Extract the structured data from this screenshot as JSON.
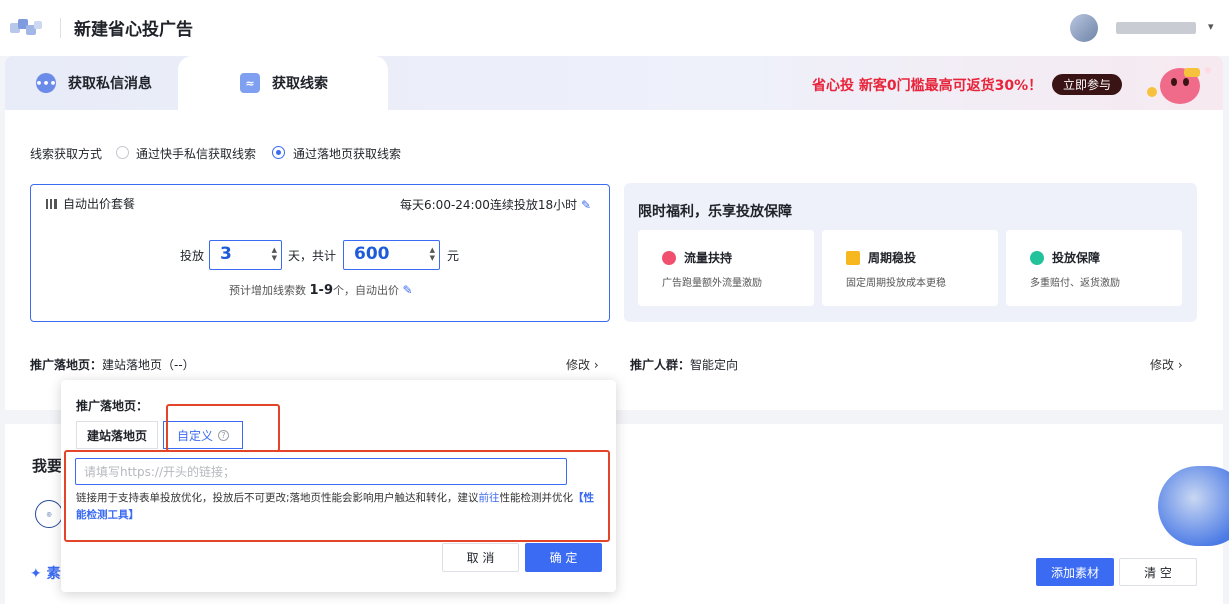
{
  "header": {
    "title": "新建省心投广告"
  },
  "tabs": [
    {
      "label": "获取私信消息"
    },
    {
      "label": "获取线索"
    }
  ],
  "promo": {
    "text": "省心投 新客0门槛最高可返货30%！",
    "button": "立即参与"
  },
  "lead_method": {
    "label": "线索获取方式",
    "options": [
      "通过快手私信获取线索",
      "通过落地页获取线索"
    ],
    "selected_index": 1
  },
  "bid_package": {
    "title": "自动出价套餐",
    "schedule": "每天6:00-24:00连续投放18小时",
    "days_label": "投放",
    "days_value": "3",
    "days_unit": "天，共计",
    "amount_value": "600",
    "amount_unit": "元",
    "estimate_prefix": "预计增加线索数",
    "estimate_range": "1-9",
    "estimate_suffix": "个，自动出价"
  },
  "benefits": {
    "title": "限时福利，乐享投放保障",
    "items": [
      {
        "name": "流量扶持",
        "desc": "广告跑量额外流量激励",
        "color": "#f0506e"
      },
      {
        "name": "周期稳投",
        "desc": "固定周期投放成本更稳",
        "color": "#f6b81e"
      },
      {
        "name": "投放保障",
        "desc": "多重赔付、返货激励",
        "color": "#21c29c"
      }
    ]
  },
  "landing_row": {
    "label": "推广落地页：",
    "value": "建站落地页（--）",
    "modify": "修改"
  },
  "audience_row": {
    "label": "推广人群：",
    "value": "智能定向",
    "modify": "修改"
  },
  "material_section": {
    "title": "我要",
    "spark_label": "素",
    "add_button": "添加素材",
    "clear_button": "清 空"
  },
  "popover": {
    "label": "推广落地页：",
    "segments": [
      "建站落地页",
      "自定义"
    ],
    "selected_segment": 1,
    "url_placeholder": "请填写https://开头的链接；",
    "url_value": "",
    "hint_main": "链接用于支持表单投放优化，投放后不可更改;落地页性能会影响用户触达和转化，建议",
    "hint_link": "前往",
    "hint_mid": "性能检测并优化",
    "hint_tool": "【性能检测工具】",
    "cancel": "取 消",
    "confirm": "确 定"
  },
  "colors": {
    "primary": "#3b6bf2",
    "highlight_box": "#e2452a",
    "promo_red": "#e8243a"
  }
}
